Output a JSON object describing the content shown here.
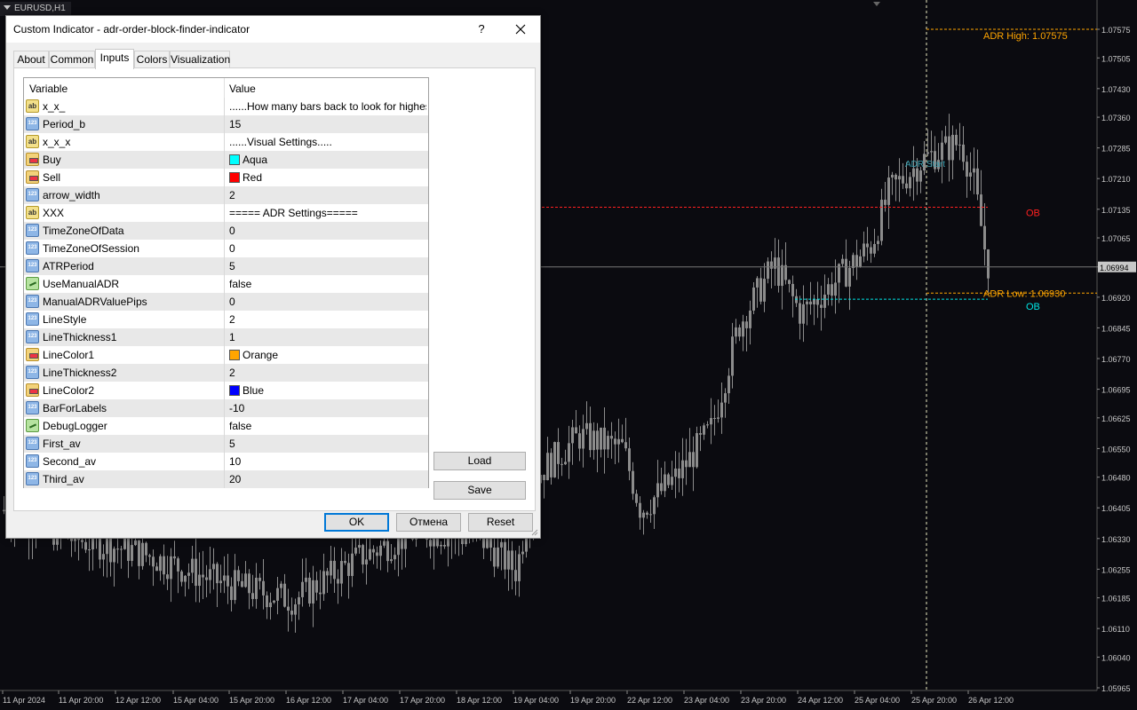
{
  "window": {
    "symbol_tab": "EURUSD,H1",
    "dialog_title": "Custom Indicator - adr-order-block-finder-indicator",
    "help_label": "?",
    "close_label": "✕"
  },
  "tabs": [
    {
      "label": "About"
    },
    {
      "label": "Common"
    },
    {
      "label": "Inputs"
    },
    {
      "label": "Colors"
    },
    {
      "label": "Visualization"
    }
  ],
  "active_tab": "Inputs",
  "grid": {
    "col_variable": "Variable",
    "col_value": "Value",
    "rows": [
      {
        "icon": "ab",
        "variable": "x_x_",
        "value": "......How many bars back to look for highest o..."
      },
      {
        "icon": "123",
        "variable": "Period_b",
        "value": "15"
      },
      {
        "icon": "ab",
        "variable": "x_x_x",
        "value": "......Visual Settings....."
      },
      {
        "icon": "color",
        "variable": "Buy",
        "value": "Aqua",
        "swatch": "#00ffff"
      },
      {
        "icon": "color",
        "variable": "Sell",
        "value": "Red",
        "swatch": "#ff0000"
      },
      {
        "icon": "123",
        "variable": "arrow_width",
        "value": "2"
      },
      {
        "icon": "ab",
        "variable": "XXX",
        "value": "===== ADR Settings====="
      },
      {
        "icon": "123",
        "variable": "TimeZoneOfData",
        "value": "0"
      },
      {
        "icon": "123",
        "variable": "TimeZoneOfSession",
        "value": "0"
      },
      {
        "icon": "123",
        "variable": "ATRPeriod",
        "value": "5"
      },
      {
        "icon": "bool",
        "variable": "UseManualADR",
        "value": "false"
      },
      {
        "icon": "123",
        "variable": "ManualADRValuePips",
        "value": "0"
      },
      {
        "icon": "123",
        "variable": "LineStyle",
        "value": "2"
      },
      {
        "icon": "123",
        "variable": "LineThickness1",
        "value": "1"
      },
      {
        "icon": "color",
        "variable": "LineColor1",
        "value": "Orange",
        "swatch": "#ffa500"
      },
      {
        "icon": "123",
        "variable": "LineThickness2",
        "value": "2"
      },
      {
        "icon": "color",
        "variable": "LineColor2",
        "value": "Blue",
        "swatch": "#0000ff"
      },
      {
        "icon": "123",
        "variable": "BarForLabels",
        "value": "-10"
      },
      {
        "icon": "bool",
        "variable": "DebugLogger",
        "value": "false"
      },
      {
        "icon": "123",
        "variable": "First_av",
        "value": "5"
      },
      {
        "icon": "123",
        "variable": "Second_av",
        "value": "10"
      },
      {
        "icon": "123",
        "variable": "Third_av",
        "value": "20"
      }
    ]
  },
  "buttons": {
    "load": "Load",
    "save": "Save",
    "ok": "OK",
    "cancel": "Отмена",
    "reset": "Reset"
  },
  "chart": {
    "price_labels": [
      "1.07575",
      "1.07505",
      "1.07430",
      "1.07360",
      "1.07285",
      "1.07210",
      "1.07135",
      "1.07065",
      "1.06994",
      "1.06920",
      "1.06845",
      "1.06770",
      "1.06695",
      "1.06625",
      "1.06550",
      "1.06480",
      "1.06405",
      "1.06330",
      "1.06255",
      "1.06185",
      "1.06110",
      "1.06040",
      "1.05965"
    ],
    "current_price": "1.06994",
    "time_labels": [
      "11 Apr 2024",
      "11 Apr 20:00",
      "12 Apr 12:00",
      "15 Apr 04:00",
      "15 Apr 20:00",
      "16 Apr 12:00",
      "17 Apr 04:00",
      "17 Apr 20:00",
      "18 Apr 12:00",
      "19 Apr 04:00",
      "19 Apr 20:00",
      "22 Apr 12:00",
      "23 Apr 04:00",
      "23 Apr 20:00",
      "24 Apr 12:00",
      "25 Apr 04:00",
      "25 Apr 20:00",
      "26 Apr 12:00"
    ],
    "adr_high_label": "ADR High: 1.07575",
    "adr_low_label": "ADR Low: 1.06930",
    "adr_start_label": "ADR Start",
    "ob_sell_label": "OB",
    "ob_buy_label": "OB",
    "colors": {
      "background": "#0b0b10",
      "candle": "#8c8c8c",
      "adr": "#ffa500",
      "ob_sell": "#ff2020",
      "ob_buy": "#00e5e5",
      "adr_start": "#3aa0b0",
      "axis_text": "#c8c8c8"
    }
  }
}
